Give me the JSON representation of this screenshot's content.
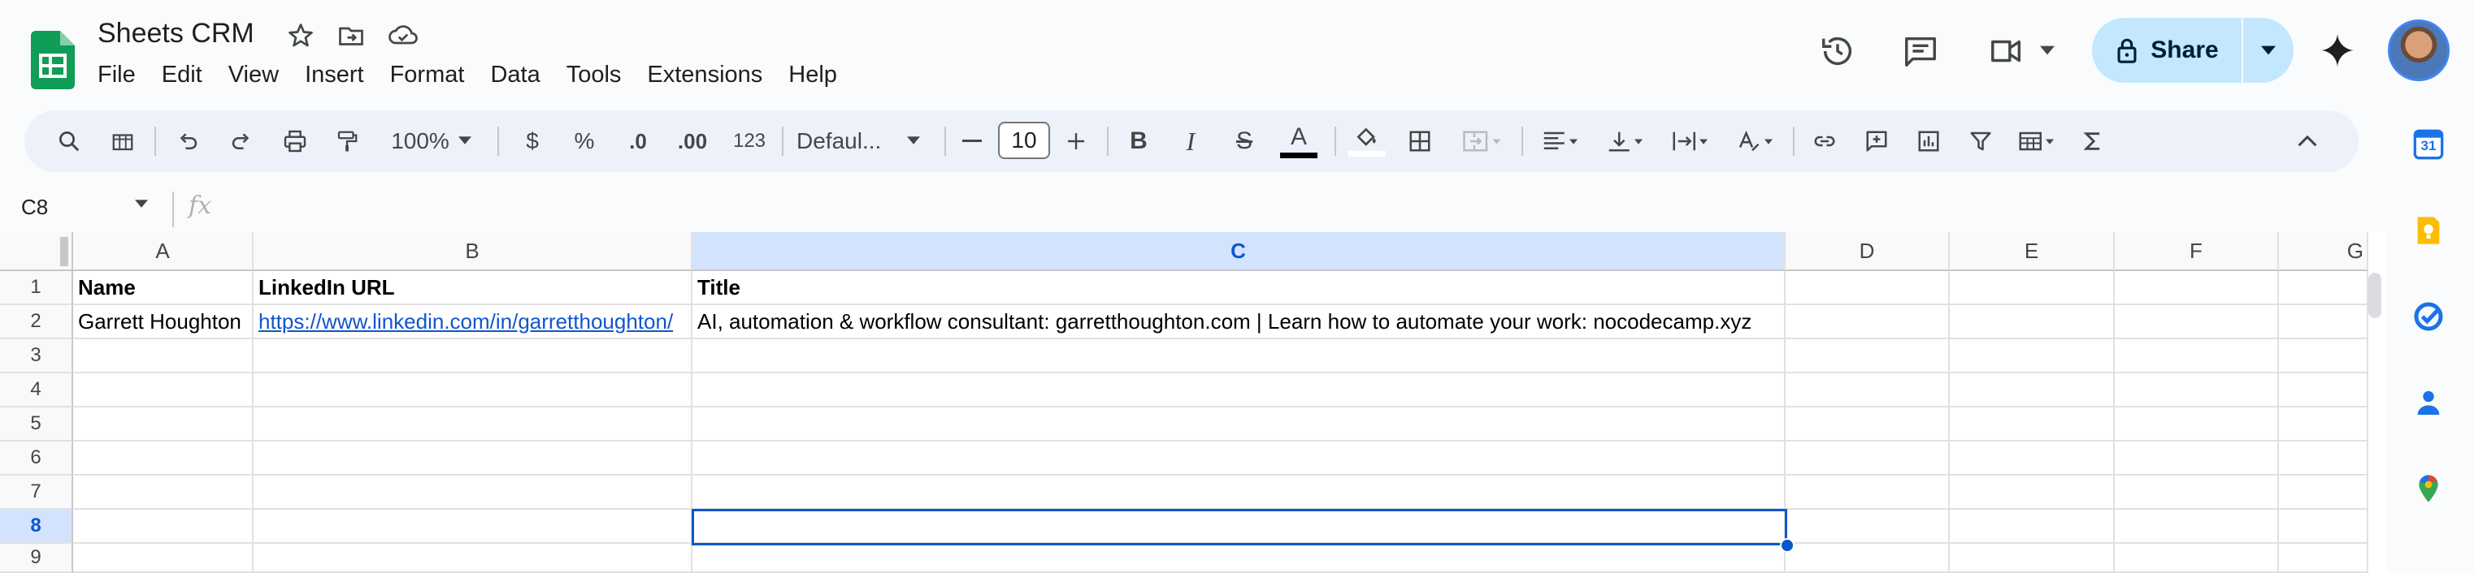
{
  "app": {
    "title": "Sheets CRM",
    "brand_color": "#0f9d58"
  },
  "menu": [
    "File",
    "Edit",
    "View",
    "Insert",
    "Format",
    "Data",
    "Tools",
    "Extensions",
    "Help"
  ],
  "header": {
    "share_label": "Share",
    "icons": [
      "star-icon",
      "move-to-folder-icon",
      "cloud-status-icon",
      "history-icon",
      "comments-icon",
      "meet-icon",
      "gemini-icon"
    ]
  },
  "toolbar": {
    "zoom": "100%",
    "currency": "$",
    "percent": "%",
    "decrease_decimal": ".0",
    "increase_decimal": ".00",
    "more_formats": "123",
    "font": "Defaul...",
    "font_size": "10",
    "bold": "B",
    "italic": "I",
    "strikethrough": "S",
    "text_color": "A"
  },
  "formula_bar": {
    "name_box": "C8",
    "fx": "fx",
    "value": ""
  },
  "grid": {
    "columns": [
      "A",
      "B",
      "C",
      "D",
      "E",
      "F",
      "G"
    ],
    "selected_column": "C",
    "rows": [
      "1",
      "2",
      "3",
      "4",
      "5",
      "6",
      "7",
      "8",
      "9"
    ],
    "selected_row": "8",
    "row1": {
      "a": "Name",
      "b": "LinkedIn URL",
      "c": "Title"
    },
    "row2": {
      "a": "Garrett Houghton",
      "b": "https://www.linkedin.com/in/garretthoughton/",
      "c": "AI, automation & workflow consultant: garretthoughton.com | Learn how to automate your work: nocodecamp.xyz"
    }
  },
  "side_panel": {
    "calendar_day": "31",
    "icons": [
      "calendar-icon",
      "keep-icon",
      "tasks-icon",
      "contacts-icon",
      "maps-icon"
    ]
  }
}
